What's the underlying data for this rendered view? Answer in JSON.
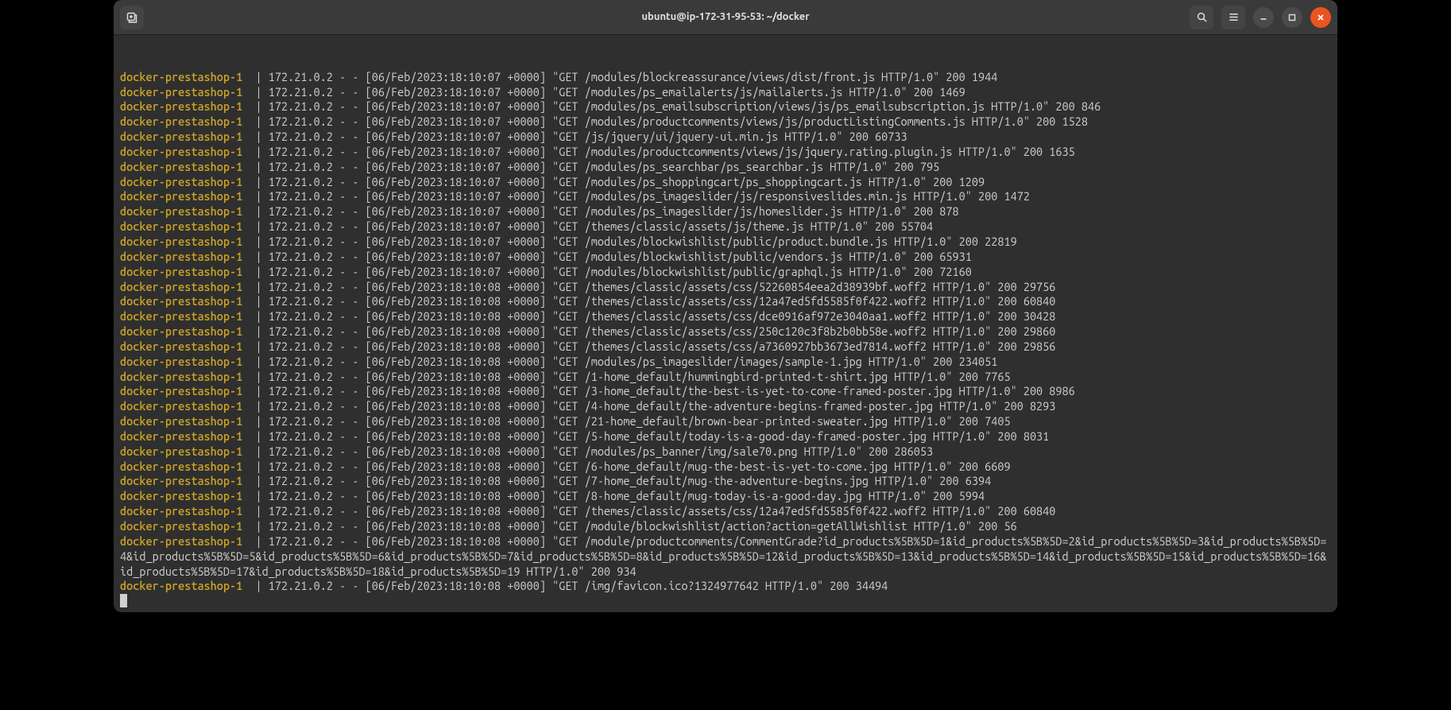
{
  "titlebar": {
    "title": "ubuntu@ip-172-31-95-53: ~/docker"
  },
  "container_name": "docker-prestashop-1",
  "sep": "  | ",
  "log_prefix": "172.21.0.2 - - ",
  "logs": [
    {
      "ts": "[06/Feb/2023:18:10:07 +0000]",
      "req": "\"GET /modules/blockreassurance/views/dist/front.js HTTP/1.0\" 200 1944"
    },
    {
      "ts": "[06/Feb/2023:18:10:07 +0000]",
      "req": "\"GET /modules/ps_emailalerts/js/mailalerts.js HTTP/1.0\" 200 1469"
    },
    {
      "ts": "[06/Feb/2023:18:10:07 +0000]",
      "req": "\"GET /modules/ps_emailsubscription/views/js/ps_emailsubscription.js HTTP/1.0\" 200 846"
    },
    {
      "ts": "[06/Feb/2023:18:10:07 +0000]",
      "req": "\"GET /modules/productcomments/views/js/productListingComments.js HTTP/1.0\" 200 1528"
    },
    {
      "ts": "[06/Feb/2023:18:10:07 +0000]",
      "req": "\"GET /js/jquery/ui/jquery-ui.min.js HTTP/1.0\" 200 60733"
    },
    {
      "ts": "[06/Feb/2023:18:10:07 +0000]",
      "req": "\"GET /modules/productcomments/views/js/jquery.rating.plugin.js HTTP/1.0\" 200 1635"
    },
    {
      "ts": "[06/Feb/2023:18:10:07 +0000]",
      "req": "\"GET /modules/ps_searchbar/ps_searchbar.js HTTP/1.0\" 200 795"
    },
    {
      "ts": "[06/Feb/2023:18:10:07 +0000]",
      "req": "\"GET /modules/ps_shoppingcart/ps_shoppingcart.js HTTP/1.0\" 200 1209"
    },
    {
      "ts": "[06/Feb/2023:18:10:07 +0000]",
      "req": "\"GET /modules/ps_imageslider/js/responsiveslides.min.js HTTP/1.0\" 200 1472"
    },
    {
      "ts": "[06/Feb/2023:18:10:07 +0000]",
      "req": "\"GET /modules/ps_imageslider/js/homeslider.js HTTP/1.0\" 200 878"
    },
    {
      "ts": "[06/Feb/2023:18:10:07 +0000]",
      "req": "\"GET /themes/classic/assets/js/theme.js HTTP/1.0\" 200 55704"
    },
    {
      "ts": "[06/Feb/2023:18:10:07 +0000]",
      "req": "\"GET /modules/blockwishlist/public/product.bundle.js HTTP/1.0\" 200 22819"
    },
    {
      "ts": "[06/Feb/2023:18:10:07 +0000]",
      "req": "\"GET /modules/blockwishlist/public/vendors.js HTTP/1.0\" 200 65931"
    },
    {
      "ts": "[06/Feb/2023:18:10:07 +0000]",
      "req": "\"GET /modules/blockwishlist/public/graphql.js HTTP/1.0\" 200 72160"
    },
    {
      "ts": "[06/Feb/2023:18:10:08 +0000]",
      "req": "\"GET /themes/classic/assets/css/52260854eea2d38939bf.woff2 HTTP/1.0\" 200 29756"
    },
    {
      "ts": "[06/Feb/2023:18:10:08 +0000]",
      "req": "\"GET /themes/classic/assets/css/12a47ed5fd5585f0f422.woff2 HTTP/1.0\" 200 60840"
    },
    {
      "ts": "[06/Feb/2023:18:10:08 +0000]",
      "req": "\"GET /themes/classic/assets/css/dce0916af972e3040aa1.woff2 HTTP/1.0\" 200 30428"
    },
    {
      "ts": "[06/Feb/2023:18:10:08 +0000]",
      "req": "\"GET /themes/classic/assets/css/250c120c3f8b2b0bb58e.woff2 HTTP/1.0\" 200 29860"
    },
    {
      "ts": "[06/Feb/2023:18:10:08 +0000]",
      "req": "\"GET /themes/classic/assets/css/a7360927bb3673ed7814.woff2 HTTP/1.0\" 200 29856"
    },
    {
      "ts": "[06/Feb/2023:18:10:08 +0000]",
      "req": "\"GET /modules/ps_imageslider/images/sample-1.jpg HTTP/1.0\" 200 234051"
    },
    {
      "ts": "[06/Feb/2023:18:10:08 +0000]",
      "req": "\"GET /1-home_default/hummingbird-printed-t-shirt.jpg HTTP/1.0\" 200 7765"
    },
    {
      "ts": "[06/Feb/2023:18:10:08 +0000]",
      "req": "\"GET /3-home_default/the-best-is-yet-to-come-framed-poster.jpg HTTP/1.0\" 200 8986"
    },
    {
      "ts": "[06/Feb/2023:18:10:08 +0000]",
      "req": "\"GET /4-home_default/the-adventure-begins-framed-poster.jpg HTTP/1.0\" 200 8293"
    },
    {
      "ts": "[06/Feb/2023:18:10:08 +0000]",
      "req": "\"GET /21-home_default/brown-bear-printed-sweater.jpg HTTP/1.0\" 200 7405"
    },
    {
      "ts": "[06/Feb/2023:18:10:08 +0000]",
      "req": "\"GET /5-home_default/today-is-a-good-day-framed-poster.jpg HTTP/1.0\" 200 8031"
    },
    {
      "ts": "[06/Feb/2023:18:10:08 +0000]",
      "req": "\"GET /modules/ps_banner/img/sale70.png HTTP/1.0\" 200 286053"
    },
    {
      "ts": "[06/Feb/2023:18:10:08 +0000]",
      "req": "\"GET /6-home_default/mug-the-best-is-yet-to-come.jpg HTTP/1.0\" 200 6609"
    },
    {
      "ts": "[06/Feb/2023:18:10:08 +0000]",
      "req": "\"GET /7-home_default/mug-the-adventure-begins.jpg HTTP/1.0\" 200 6394"
    },
    {
      "ts": "[06/Feb/2023:18:10:08 +0000]",
      "req": "\"GET /8-home_default/mug-today-is-a-good-day.jpg HTTP/1.0\" 200 5994"
    },
    {
      "ts": "[06/Feb/2023:18:10:08 +0000]",
      "req": "\"GET /themes/classic/assets/css/12a47ed5fd5585f0f422.woff2 HTTP/1.0\" 200 60840"
    },
    {
      "ts": "[06/Feb/2023:18:10:08 +0000]",
      "req": "\"GET /module/blockwishlist/action?action=getAllWishlist HTTP/1.0\" 200 56"
    },
    {
      "ts": "[06/Feb/2023:18:10:08 +0000]",
      "req": "\"GET /module/productcomments/CommentGrade?id_products%5B%5D=1&id_products%5B%5D=2&id_products%5B%5D=3&id_products%5B%5D=4&id_products%5B%5D=5&id_products%5B%5D=6&id_products%5B%5D=7&id_products%5B%5D=8&id_products%5B%5D=12&id_products%5B%5D=13&id_products%5B%5D=14&id_products%5B%5D=15&id_products%5B%5D=16&id_products%5B%5D=17&id_products%5B%5D=18&id_products%5B%5D=19 HTTP/1.0\" 200 934"
    },
    {
      "ts": "[06/Feb/2023:18:10:08 +0000]",
      "req": "\"GET /img/favicon.ico?1324977642 HTTP/1.0\" 200 34494"
    }
  ]
}
